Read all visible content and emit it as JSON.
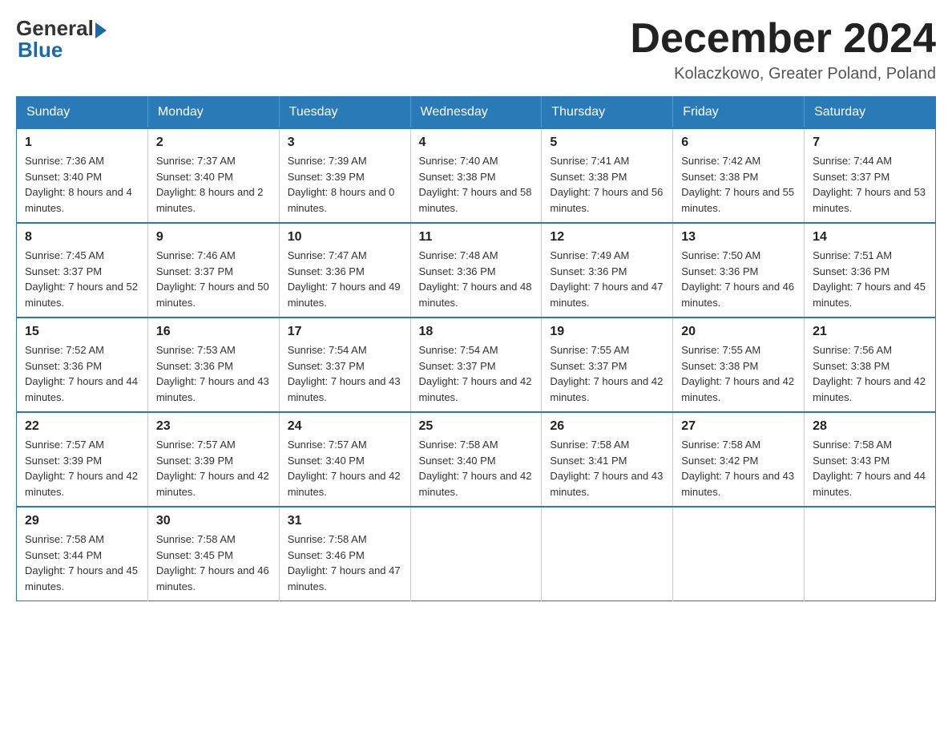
{
  "logo": {
    "general": "General",
    "blue": "Blue"
  },
  "title": {
    "month": "December 2024",
    "location": "Kolaczkowo, Greater Poland, Poland"
  },
  "days_header": [
    "Sunday",
    "Monday",
    "Tuesday",
    "Wednesday",
    "Thursday",
    "Friday",
    "Saturday"
  ],
  "weeks": [
    [
      {
        "day": "1",
        "sunrise": "7:36 AM",
        "sunset": "3:40 PM",
        "daylight": "8 hours and 4 minutes."
      },
      {
        "day": "2",
        "sunrise": "7:37 AM",
        "sunset": "3:40 PM",
        "daylight": "8 hours and 2 minutes."
      },
      {
        "day": "3",
        "sunrise": "7:39 AM",
        "sunset": "3:39 PM",
        "daylight": "8 hours and 0 minutes."
      },
      {
        "day": "4",
        "sunrise": "7:40 AM",
        "sunset": "3:38 PM",
        "daylight": "7 hours and 58 minutes."
      },
      {
        "day": "5",
        "sunrise": "7:41 AM",
        "sunset": "3:38 PM",
        "daylight": "7 hours and 56 minutes."
      },
      {
        "day": "6",
        "sunrise": "7:42 AM",
        "sunset": "3:38 PM",
        "daylight": "7 hours and 55 minutes."
      },
      {
        "day": "7",
        "sunrise": "7:44 AM",
        "sunset": "3:37 PM",
        "daylight": "7 hours and 53 minutes."
      }
    ],
    [
      {
        "day": "8",
        "sunrise": "7:45 AM",
        "sunset": "3:37 PM",
        "daylight": "7 hours and 52 minutes."
      },
      {
        "day": "9",
        "sunrise": "7:46 AM",
        "sunset": "3:37 PM",
        "daylight": "7 hours and 50 minutes."
      },
      {
        "day": "10",
        "sunrise": "7:47 AM",
        "sunset": "3:36 PM",
        "daylight": "7 hours and 49 minutes."
      },
      {
        "day": "11",
        "sunrise": "7:48 AM",
        "sunset": "3:36 PM",
        "daylight": "7 hours and 48 minutes."
      },
      {
        "day": "12",
        "sunrise": "7:49 AM",
        "sunset": "3:36 PM",
        "daylight": "7 hours and 47 minutes."
      },
      {
        "day": "13",
        "sunrise": "7:50 AM",
        "sunset": "3:36 PM",
        "daylight": "7 hours and 46 minutes."
      },
      {
        "day": "14",
        "sunrise": "7:51 AM",
        "sunset": "3:36 PM",
        "daylight": "7 hours and 45 minutes."
      }
    ],
    [
      {
        "day": "15",
        "sunrise": "7:52 AM",
        "sunset": "3:36 PM",
        "daylight": "7 hours and 44 minutes."
      },
      {
        "day": "16",
        "sunrise": "7:53 AM",
        "sunset": "3:36 PM",
        "daylight": "7 hours and 43 minutes."
      },
      {
        "day": "17",
        "sunrise": "7:54 AM",
        "sunset": "3:37 PM",
        "daylight": "7 hours and 43 minutes."
      },
      {
        "day": "18",
        "sunrise": "7:54 AM",
        "sunset": "3:37 PM",
        "daylight": "7 hours and 42 minutes."
      },
      {
        "day": "19",
        "sunrise": "7:55 AM",
        "sunset": "3:37 PM",
        "daylight": "7 hours and 42 minutes."
      },
      {
        "day": "20",
        "sunrise": "7:55 AM",
        "sunset": "3:38 PM",
        "daylight": "7 hours and 42 minutes."
      },
      {
        "day": "21",
        "sunrise": "7:56 AM",
        "sunset": "3:38 PM",
        "daylight": "7 hours and 42 minutes."
      }
    ],
    [
      {
        "day": "22",
        "sunrise": "7:57 AM",
        "sunset": "3:39 PM",
        "daylight": "7 hours and 42 minutes."
      },
      {
        "day": "23",
        "sunrise": "7:57 AM",
        "sunset": "3:39 PM",
        "daylight": "7 hours and 42 minutes."
      },
      {
        "day": "24",
        "sunrise": "7:57 AM",
        "sunset": "3:40 PM",
        "daylight": "7 hours and 42 minutes."
      },
      {
        "day": "25",
        "sunrise": "7:58 AM",
        "sunset": "3:40 PM",
        "daylight": "7 hours and 42 minutes."
      },
      {
        "day": "26",
        "sunrise": "7:58 AM",
        "sunset": "3:41 PM",
        "daylight": "7 hours and 43 minutes."
      },
      {
        "day": "27",
        "sunrise": "7:58 AM",
        "sunset": "3:42 PM",
        "daylight": "7 hours and 43 minutes."
      },
      {
        "day": "28",
        "sunrise": "7:58 AM",
        "sunset": "3:43 PM",
        "daylight": "7 hours and 44 minutes."
      }
    ],
    [
      {
        "day": "29",
        "sunrise": "7:58 AM",
        "sunset": "3:44 PM",
        "daylight": "7 hours and 45 minutes."
      },
      {
        "day": "30",
        "sunrise": "7:58 AM",
        "sunset": "3:45 PM",
        "daylight": "7 hours and 46 minutes."
      },
      {
        "day": "31",
        "sunrise": "7:58 AM",
        "sunset": "3:46 PM",
        "daylight": "7 hours and 47 minutes."
      },
      null,
      null,
      null,
      null
    ]
  ]
}
